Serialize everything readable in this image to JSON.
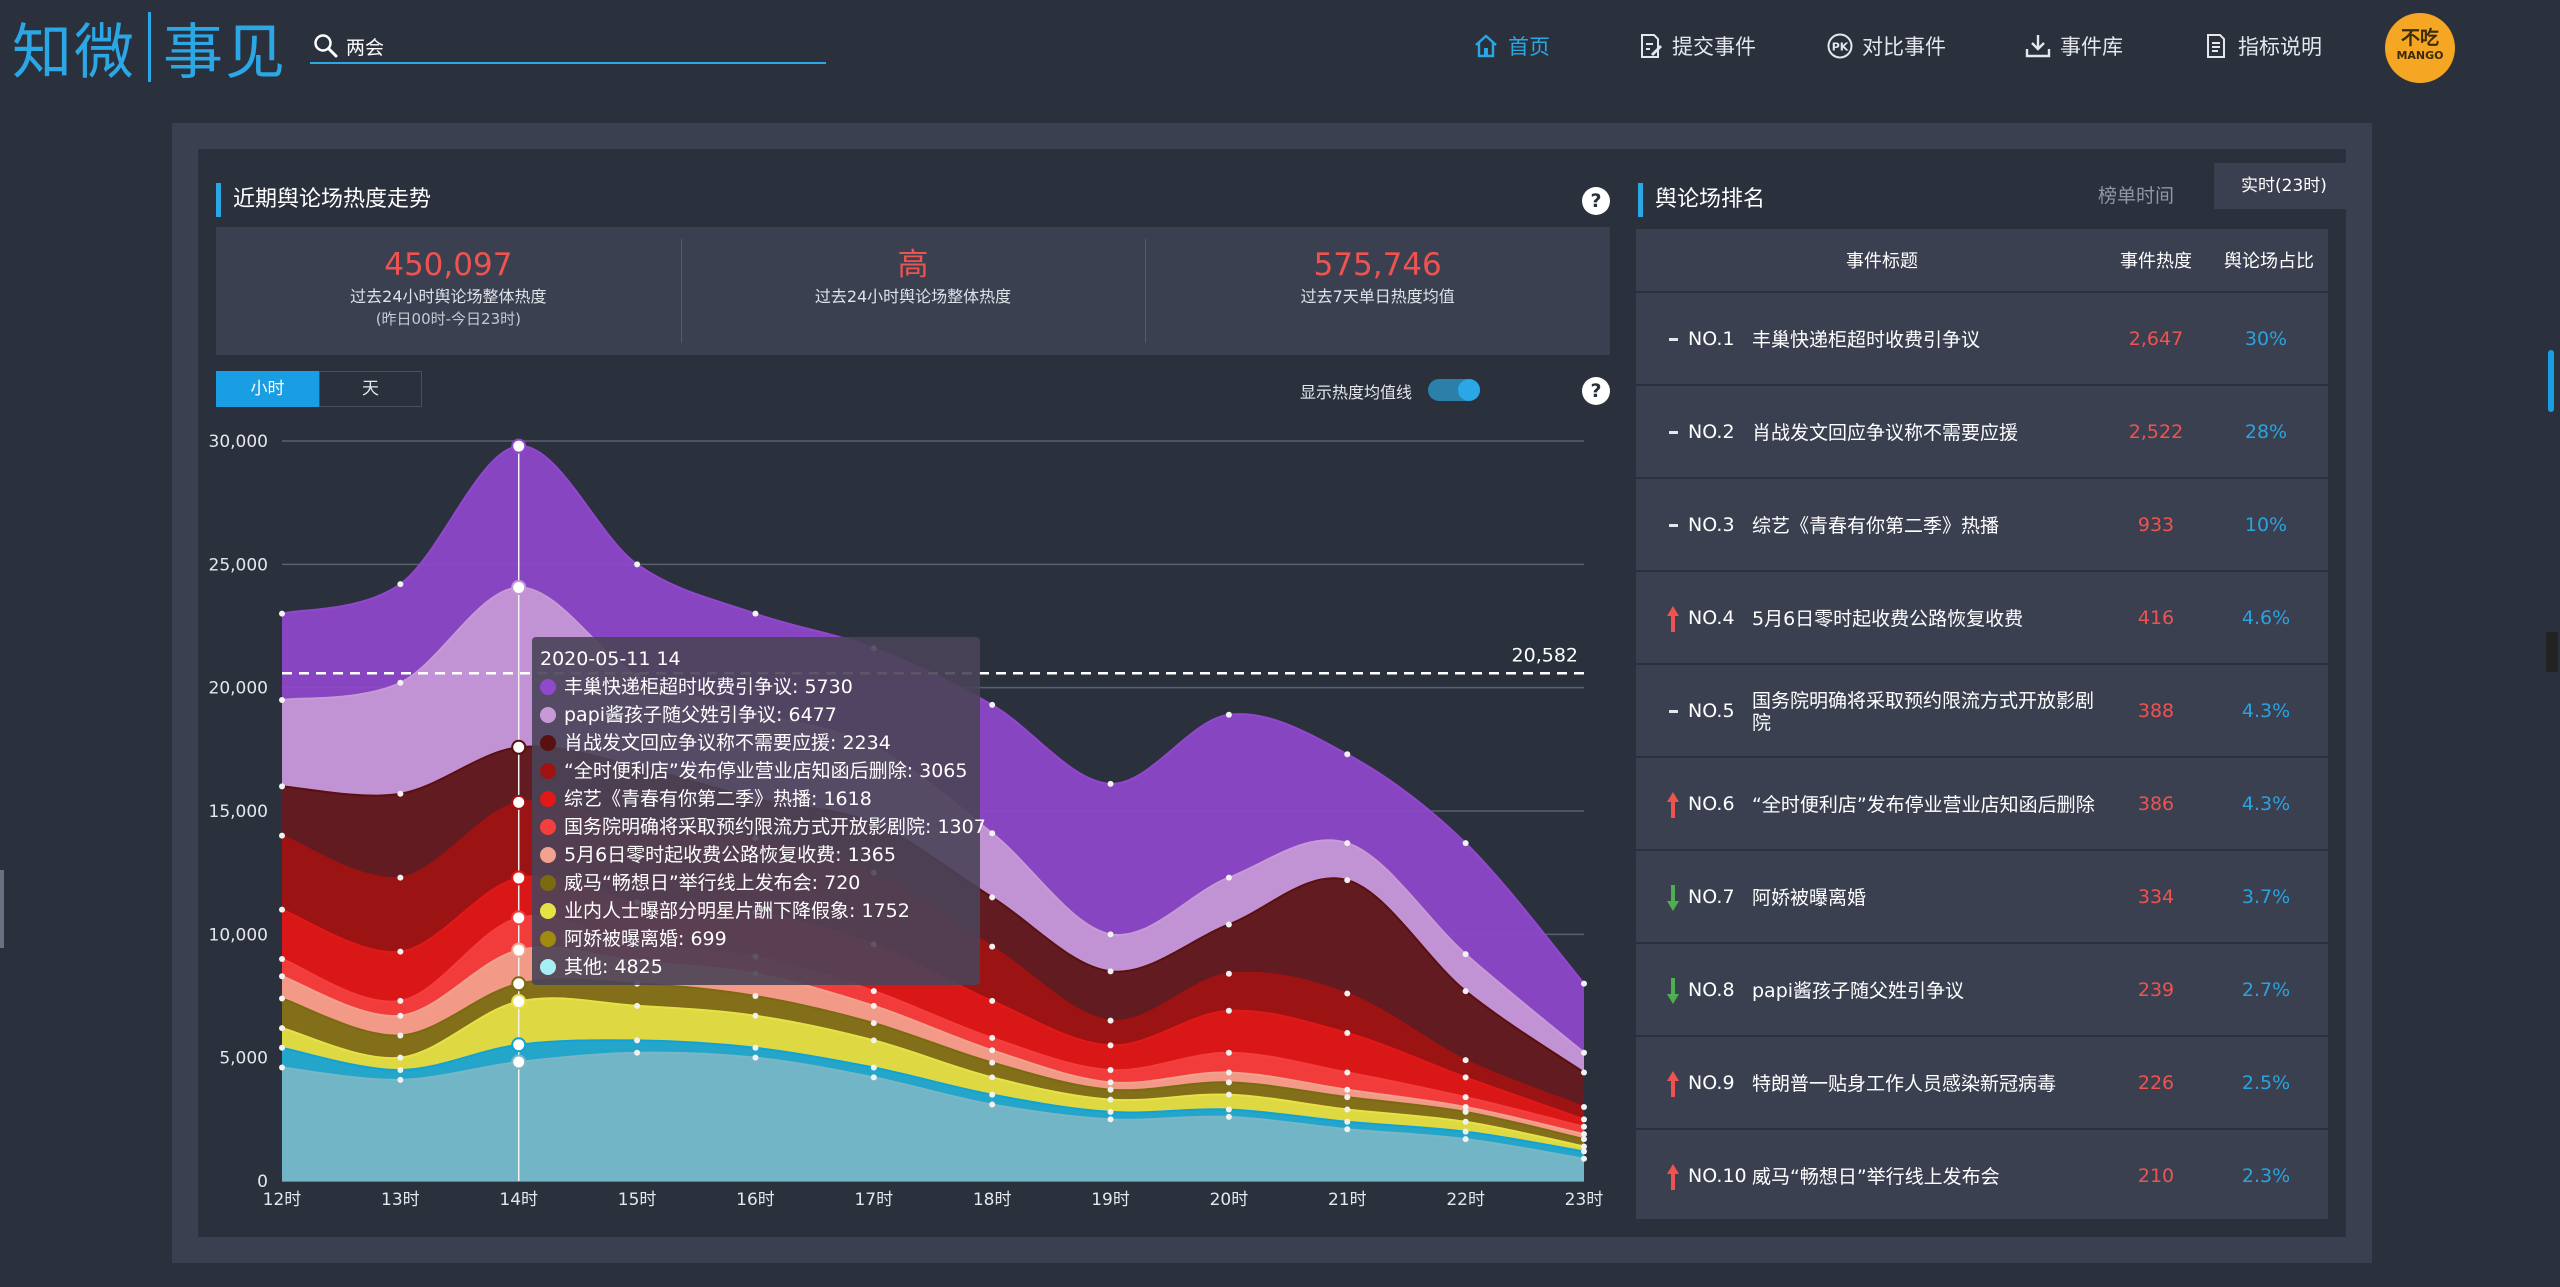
{
  "brand": {
    "logo_left": "知微",
    "logo_right": "事见"
  },
  "search": {
    "value": "两会"
  },
  "nav": {
    "home": "首页",
    "submit": "提交事件",
    "compare": "对比事件",
    "library": "事件库",
    "guide": "指标说明"
  },
  "user": {
    "avatar_top": "不吃",
    "avatar_bottom": "MANGO"
  },
  "trend": {
    "title": "近期舆论场热度走势",
    "help": "?",
    "stats": [
      {
        "value": "450,097",
        "label": "过去24小时舆论场整体热度",
        "sub": "(昨日00时-今日23时)"
      },
      {
        "value": "高",
        "label": "过去24小时舆论场整体热度",
        "sub": ""
      },
      {
        "value": "575,746",
        "label": "过去7天单日热度均值",
        "sub": ""
      }
    ],
    "tabs": [
      "小时",
      "天"
    ],
    "toggle_label": "显示热度均值线",
    "avg_label": "20,582"
  },
  "chart_data": {
    "type": "area",
    "stacked": true,
    "x": [
      "12时",
      "13时",
      "14时",
      "15时",
      "16时",
      "17时",
      "18时",
      "19时",
      "20时",
      "21时",
      "22时",
      "23时"
    ],
    "ylim": [
      0,
      30000
    ],
    "yticks": [
      "0",
      "5,000",
      "10,000",
      "15,000",
      "20,000",
      "25,000",
      "30,000"
    ],
    "avg_line": 20582,
    "series": [
      {
        "name": "其他",
        "color": "#7ab6c6",
        "values": [
          4600,
          4100,
          4825,
          5200,
          5000,
          4200,
          3100,
          2500,
          2600,
          2100,
          1700,
          900
        ]
      },
      {
        "name": "阿娇被曝离婚",
        "color": "#12a2d6",
        "values": [
          800,
          400,
          699,
          500,
          400,
          400,
          400,
          300,
          300,
          300,
          300,
          300
        ]
      },
      {
        "name": "业内人士曝部分明星片酬下降假象",
        "color": "#e6e245",
        "values": [
          800,
          500,
          1752,
          1400,
          1300,
          1100,
          700,
          500,
          600,
          500,
          400,
          200
        ]
      },
      {
        "name": "威马“畅想日”举行线上发布会",
        "color": "#7a6a10",
        "values": [
          1200,
          900,
          720,
          900,
          800,
          700,
          600,
          400,
          500,
          500,
          400,
          300
        ]
      },
      {
        "name": "5月6日零时起收费公路恢复收费",
        "color": "#f2a28e",
        "values": [
          900,
          800,
          1365,
          900,
          900,
          700,
          500,
          300,
          400,
          300,
          200,
          200
        ]
      },
      {
        "name": "国务院明确将采取预约限流方式开放影剧院",
        "color": "#f43f3f",
        "values": [
          700,
          600,
          1307,
          700,
          700,
          600,
          500,
          500,
          800,
          700,
          400,
          300
        ]
      },
      {
        "name": "综艺《青春有你第二季》热播",
        "color": "#e01818",
        "values": [
          2000,
          2000,
          1618,
          1700,
          1800,
          1900,
          1500,
          1000,
          1700,
          1600,
          800,
          300
        ]
      },
      {
        "name": "“全时便利店”发布停业营业店知函后删除",
        "color": "#a01212",
        "values": [
          3000,
          3000,
          3065,
          3000,
          3000,
          2900,
          2200,
          1000,
          1500,
          1600,
          700,
          500
        ]
      },
      {
        "name": "肖战发文回应争议称不需要应援",
        "color": "#5a1010",
        "values": [
          2000,
          3400,
          2234,
          2500,
          1600,
          2000,
          2000,
          2000,
          2000,
          4600,
          2800,
          1400
        ]
      },
      {
        "name": "papi酱孩子随父姓引争议",
        "color": "#c79ad6",
        "values": [
          3500,
          4500,
          6477,
          3700,
          3500,
          3100,
          2600,
          1500,
          1900,
          1500,
          1500,
          800
        ]
      },
      {
        "name": "丰巢快递柜超时收费引争议",
        "color": "#9048cc",
        "values": [
          3500,
          4000,
          5730,
          4500,
          4000,
          4000,
          5200,
          6100,
          6600,
          3600,
          4500,
          2800
        ]
      }
    ],
    "tooltip": {
      "title": "2020-05-11 14",
      "items": [
        {
          "name": "丰巢快递柜超时收费引争议",
          "value": "5730",
          "color": "#9048cc"
        },
        {
          "name": "papi酱孩子随父姓引争议",
          "value": "6477",
          "color": "#c79ad6"
        },
        {
          "name": "肖战发文回应争议称不需要应援",
          "value": "2234",
          "color": "#5a1010"
        },
        {
          "name": "“全时便利店”发布停业营业店知函后删除",
          "value": "3065",
          "color": "#a01212"
        },
        {
          "name": "综艺《青春有你第二季》热播",
          "value": "1618",
          "color": "#e01818"
        },
        {
          "name": "国务院明确将采取预约限流方式开放影剧院",
          "value": "1307",
          "color": "#f43f3f"
        },
        {
          "name": "5月6日零时起收费公路恢复收费",
          "value": "1365",
          "color": "#f2a28e"
        },
        {
          "name": "威马“畅想日”举行线上发布会",
          "value": "720",
          "color": "#7a6a10"
        },
        {
          "name": "业内人士曝部分明星片酬下降假象",
          "value": "1752",
          "color": "#e6e245"
        },
        {
          "name": "阿娇被曝离婚",
          "value": "699",
          "color": "#a08a10"
        },
        {
          "name": "其他",
          "value": "4825",
          "color": "#a8eef5"
        }
      ]
    }
  },
  "ranking": {
    "title": "舆论场排名",
    "time_label": "榜单时间",
    "time_value": "实时(23时)",
    "headers": [
      "事件标题",
      "事件热度",
      "舆论场占比"
    ],
    "rows": [
      {
        "trend": "flat",
        "no": "NO.1",
        "title": "丰巢快递柜超时收费引争议",
        "heat": "2,647",
        "pct": "30%"
      },
      {
        "trend": "flat",
        "no": "NO.2",
        "title": "肖战发文回应争议称不需要应援",
        "heat": "2,522",
        "pct": "28%"
      },
      {
        "trend": "flat",
        "no": "NO.3",
        "title": "综艺《青春有你第二季》热播",
        "heat": "933",
        "pct": "10%"
      },
      {
        "trend": "up",
        "no": "NO.4",
        "title": "5月6日零时起收费公路恢复收费",
        "heat": "416",
        "pct": "4.6%"
      },
      {
        "trend": "flat",
        "no": "NO.5",
        "title": "国务院明确将采取预约限流方式开放影剧院",
        "heat": "388",
        "pct": "4.3%"
      },
      {
        "trend": "up",
        "no": "NO.6",
        "title": "“全时便利店”发布停业营业店知函后删除",
        "heat": "386",
        "pct": "4.3%"
      },
      {
        "trend": "down",
        "no": "NO.7",
        "title": "阿娇被曝离婚",
        "heat": "334",
        "pct": "3.7%"
      },
      {
        "trend": "down",
        "no": "NO.8",
        "title": "papi酱孩子随父姓引争议",
        "heat": "239",
        "pct": "2.7%"
      },
      {
        "trend": "up",
        "no": "NO.9",
        "title": "特朗普一贴身工作人员感染新冠病毒",
        "heat": "226",
        "pct": "2.5%"
      },
      {
        "trend": "up",
        "no": "NO.10",
        "title": "威马“畅想日”举行线上发布会",
        "heat": "210",
        "pct": "2.3%"
      }
    ]
  }
}
